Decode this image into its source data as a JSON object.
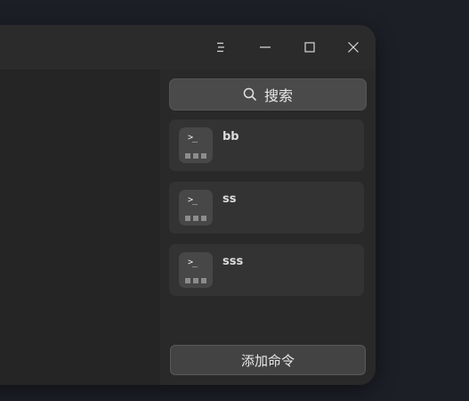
{
  "window_controls": {
    "icons": [
      "menu-icon",
      "minimize-icon",
      "maximize-icon",
      "close-icon"
    ]
  },
  "panel": {
    "search_label": "搜索",
    "commands": [
      {
        "name": "bb",
        "icon": "terminal-icon"
      },
      {
        "name": "ss",
        "icon": "terminal-icon"
      },
      {
        "name": "sss",
        "icon": "terminal-icon"
      }
    ],
    "add_command_label": "添加命令"
  },
  "colors": {
    "window_bg": "#262626",
    "panel_bg": "#292929",
    "card_bg": "#333333",
    "search_bg": "#4a4a4a",
    "desktop_bg": "#1d1f27"
  }
}
